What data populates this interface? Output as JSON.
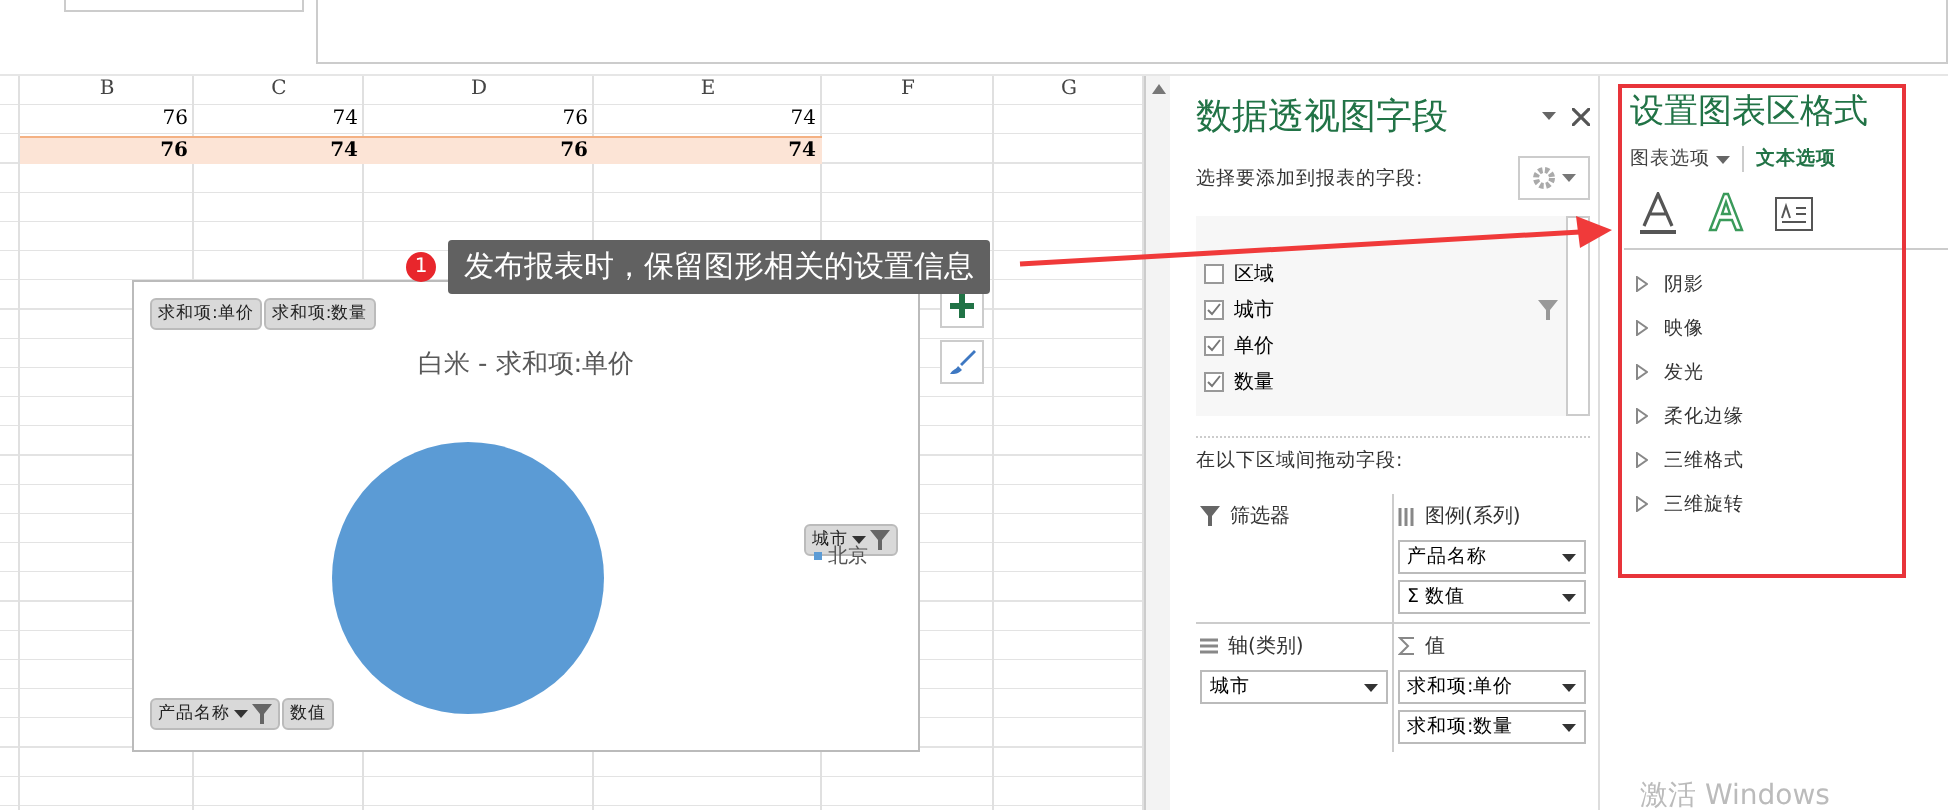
{
  "sheet": {
    "columns": [
      "B",
      "C",
      "D",
      "E",
      "F",
      "G"
    ],
    "rows": [
      {
        "bold": false,
        "highlighted": false,
        "cells": [
          "76",
          "74",
          "76",
          "74"
        ]
      },
      {
        "bold": true,
        "highlighted": true,
        "cells": [
          "76",
          "74",
          "76",
          "74"
        ]
      }
    ]
  },
  "chart": {
    "field_buttons_top": [
      "求和项:单价",
      "求和项:数量"
    ],
    "field_buttons_bottom": [
      {
        "label": "产品名称",
        "filter": true
      },
      {
        "label": "数值",
        "filter": false
      }
    ],
    "legend_button": "城市",
    "title": "白米 - 求和项:单价",
    "legend": [
      {
        "label": "北京",
        "color": "#5b9bd5"
      }
    ]
  },
  "callout": {
    "badge": "1",
    "text": "发布报表时，保留图形相关的设置信息"
  },
  "pivot_pane": {
    "title": "数据透视图字段",
    "prompt": "选择要添加到报表的字段:",
    "fields": [
      {
        "label": "区域",
        "checked": false,
        "filtered": false
      },
      {
        "label": "城市",
        "checked": true,
        "filtered": true
      },
      {
        "label": "单价",
        "checked": true,
        "filtered": false
      },
      {
        "label": "数量",
        "checked": true,
        "filtered": false
      }
    ],
    "drag_prompt": "在以下区域间拖动字段:",
    "areas": [
      {
        "kind": "filter",
        "label": "筛选器"
      },
      {
        "kind": "legend",
        "label": "图例(系列)",
        "items": [
          {
            "label": "产品名称"
          },
          {
            "prefix": "Σ",
            "label": "数值"
          }
        ]
      },
      {
        "kind": "axis",
        "label": "轴(类别)",
        "items": [
          {
            "label": "城市"
          }
        ]
      },
      {
        "kind": "values",
        "label": "值",
        "items": [
          {
            "label": "求和项:单价"
          },
          {
            "label": "求和项:数量"
          }
        ]
      }
    ]
  },
  "format_pane": {
    "title": "设置图表区格式",
    "tabs": [
      {
        "label": "图表选项",
        "selected": false
      },
      {
        "label": "文本选项",
        "selected": true
      }
    ],
    "icon_tabs": [
      {
        "kind": "fill",
        "selected": false
      },
      {
        "kind": "outline",
        "selected": true
      },
      {
        "kind": "textbox",
        "selected": false
      }
    ],
    "sections": [
      {
        "label": "阴影",
        "expanded": false
      },
      {
        "label": "映像",
        "expanded": false
      },
      {
        "label": "发光",
        "expanded": false
      },
      {
        "label": "柔化边缘",
        "expanded": false
      },
      {
        "label": "三维格式",
        "expanded": false
      },
      {
        "label": "三维旋转",
        "expanded": false
      }
    ]
  },
  "os_notice": "激活 Windows"
}
